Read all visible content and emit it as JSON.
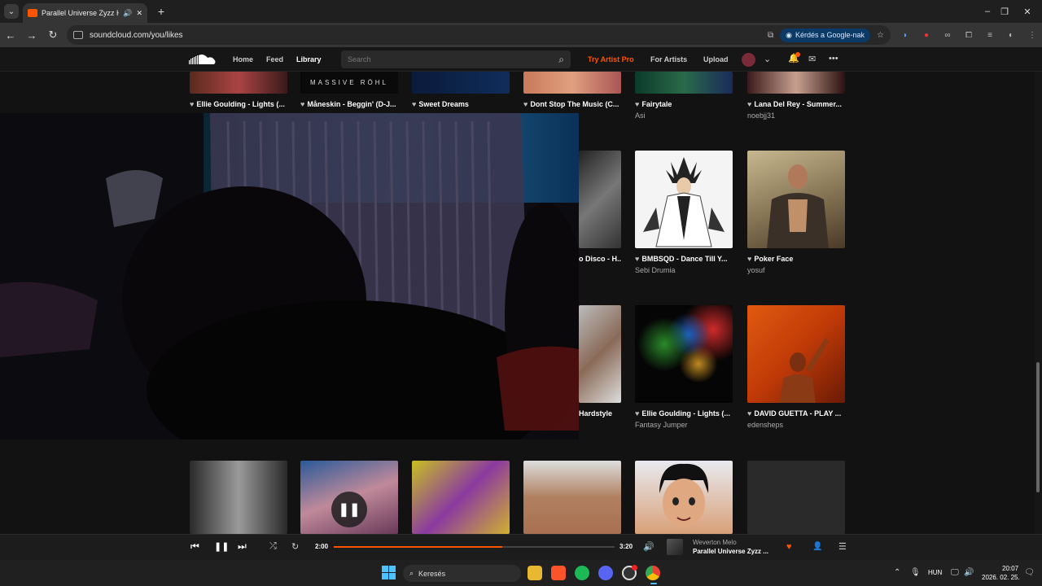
{
  "browser": {
    "tab_title": "Parallel Universe Zyzz Hards",
    "tab_audio_icon": "speaker-icon",
    "new_tab": "+",
    "window_controls": [
      "–",
      "❐",
      "✕"
    ],
    "url": "soundcloud.com/you/likes",
    "google_button": "Kérdés a Google-nak"
  },
  "nav": {
    "home": "Home",
    "feed": "Feed",
    "library": "Library",
    "search_placeholder": "Search",
    "try_artist_pro": "Try Artist Pro",
    "for_artists": "For Artists",
    "upload": "Upload"
  },
  "row1": [
    {
      "title": "Ellie Goulding - Lights (...",
      "sub": ""
    },
    {
      "title": "Måneskin - Beggin' (D-J...",
      "sub": "",
      "art_text": "MASSIVE RÖHL"
    },
    {
      "title": "Sweet Dreams",
      "sub": ""
    },
    {
      "title": "Dont Stop The Music (C...",
      "sub": ""
    },
    {
      "title": "Fairytale",
      "sub": "Asi"
    },
    {
      "title": "Lana Del Rey - Summer...",
      "sub": "noebjj31"
    }
  ],
  "row2": [
    {
      "title": "o Disco - H...",
      "sub": ""
    },
    {
      "title": "BMBSQD - Dance Till Y...",
      "sub": "Sebi Drumia"
    },
    {
      "title": "Poker Face",
      "sub": "yosuf"
    }
  ],
  "row3": [
    {
      "title": "Hardstyle",
      "sub": ""
    },
    {
      "title": "Ellie Goulding - Lights (...",
      "sub": "Fantasy Jumper"
    },
    {
      "title": "DAVID GUETTA - PLAY ...",
      "sub": "edensheps"
    }
  ],
  "player": {
    "elapsed": "2:00",
    "duration": "3:20",
    "progress": 0.6,
    "artist": "Weverton Melo",
    "track": "Parallel Universe Zyzz ..."
  },
  "taskbar": {
    "search": "Keresés",
    "lang": "HUN",
    "time": "20:07",
    "date": "2026. 02. 25."
  },
  "colors": {
    "accent": "#ff5500"
  }
}
